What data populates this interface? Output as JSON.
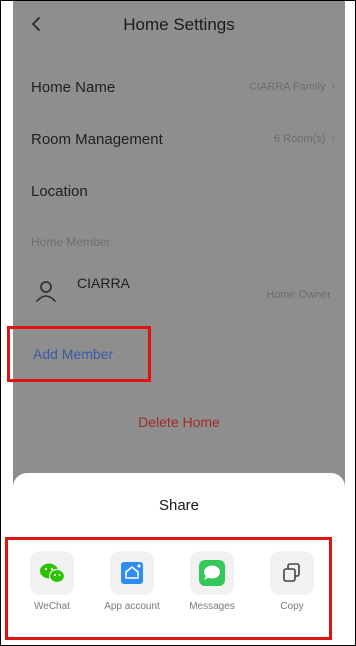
{
  "nav": {
    "title": "Home Settings",
    "back_icon": "chevron-left-icon"
  },
  "settings": {
    "home_name": {
      "label": "Home Name",
      "value": "CIARRA Family"
    },
    "room_management": {
      "label": "Room Management",
      "value": "6 Room(s)"
    },
    "location": {
      "label": "Location"
    },
    "home_member_section": "Home Member",
    "member": {
      "name": "CIARRA",
      "role": "Home Owner",
      "icon": "user-icon"
    },
    "add_member": "Add Member",
    "delete_home": "Delete Home"
  },
  "share_sheet": {
    "title": "Share",
    "items": [
      {
        "label": "WeChat",
        "icon": "wechat-icon",
        "color": "#2dc100"
      },
      {
        "label": "App account",
        "icon": "app-account-icon",
        "color": "#2f8cf4"
      },
      {
        "label": "Messages",
        "icon": "messages-icon",
        "color": "#34c759"
      },
      {
        "label": "Copy",
        "icon": "copy-icon",
        "color": "#444444"
      }
    ]
  },
  "colors": {
    "overlay_background": "#8e8e8e",
    "add_member_text": "#3a5aa8",
    "delete_text": "#a42a2a",
    "highlight_box": "#e01212"
  }
}
